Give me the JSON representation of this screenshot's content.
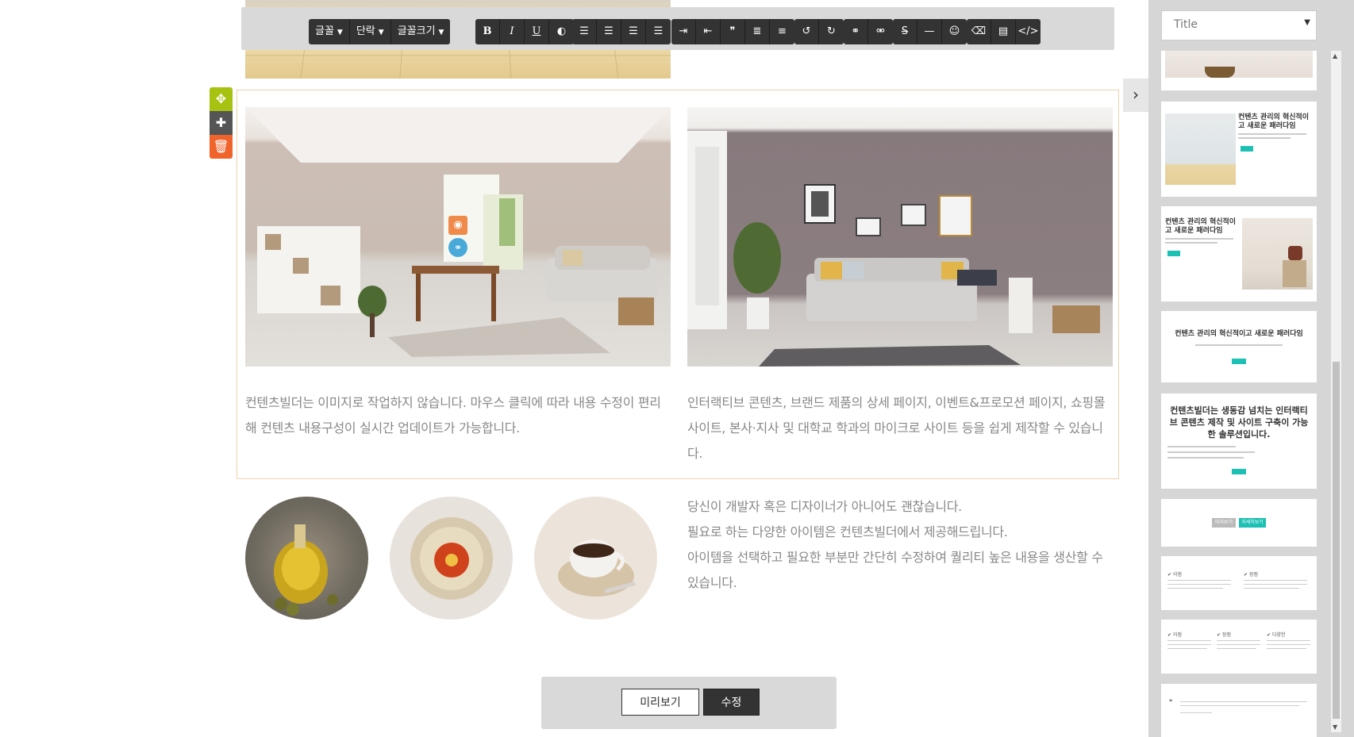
{
  "toolbar": {
    "dropdowns": [
      "글꼴",
      "단락",
      "글꼴크기"
    ],
    "bold": "B",
    "italic": "I",
    "underline": "U"
  },
  "block": {
    "left_text": "컨텐츠빌더는 이미지로 작업하지 않습니다. 마우스 클릭에 따라 내용 수정이 편리해 컨텐츠 내용구성이 실시간 업데이트가 가능합니다.",
    "right_text": "인터랙티브 콘텐츠, 브랜드 제품의 상세 페이지, 이벤트&프로모션 페이지, 쇼핑몰 사이트, 본사·지사 및 대학교 학과의 마이크로 사이트 등을 쉽게 제작할 수 있습니다."
  },
  "feature": {
    "lines": [
      "당신이 개발자 혹은 디자이너가 아니어도 괜찮습니다.",
      "필요로 하는 다양한 아이템은 컨텐츠빌더에서 제공해드립니다.",
      "아이템을 선택하고 필요한 부분만 간단히 수정하여 퀄리티 높은 내용을 생산할 수 있습니다."
    ]
  },
  "bottom": {
    "preview_label": "미리보기",
    "edit_label": "수정"
  },
  "panel": {
    "select_value": "Title",
    "thumbs": {
      "t2_title": "컨텐츠 관리의 혁신적이고 새로운 패러다임",
      "t3_title": "컨텐츠 관리의 혁신적이고 새로운 패러다임",
      "t4_title": "컨텐츠 관리의 혁신적이고 새로운 패러다임",
      "t5_title": "컨텐츠빌더는 생동감 넘치는 인터랙티브 콘텐츠 제작 및 사이트 구축이 가능한 솔루션입니다.",
      "t6_btn1": "미리보기",
      "t6_btn2": "자세히보기",
      "t7_left": "이점",
      "t7_right": "장점",
      "t8_a": "이점",
      "t8_b": "장점",
      "t8_c": "다양한"
    }
  },
  "colors": {
    "accent": "#1cc0b4",
    "move": "#a8c212",
    "add": "#555555",
    "delete": "#f0642c",
    "toolbar": "#333333"
  }
}
